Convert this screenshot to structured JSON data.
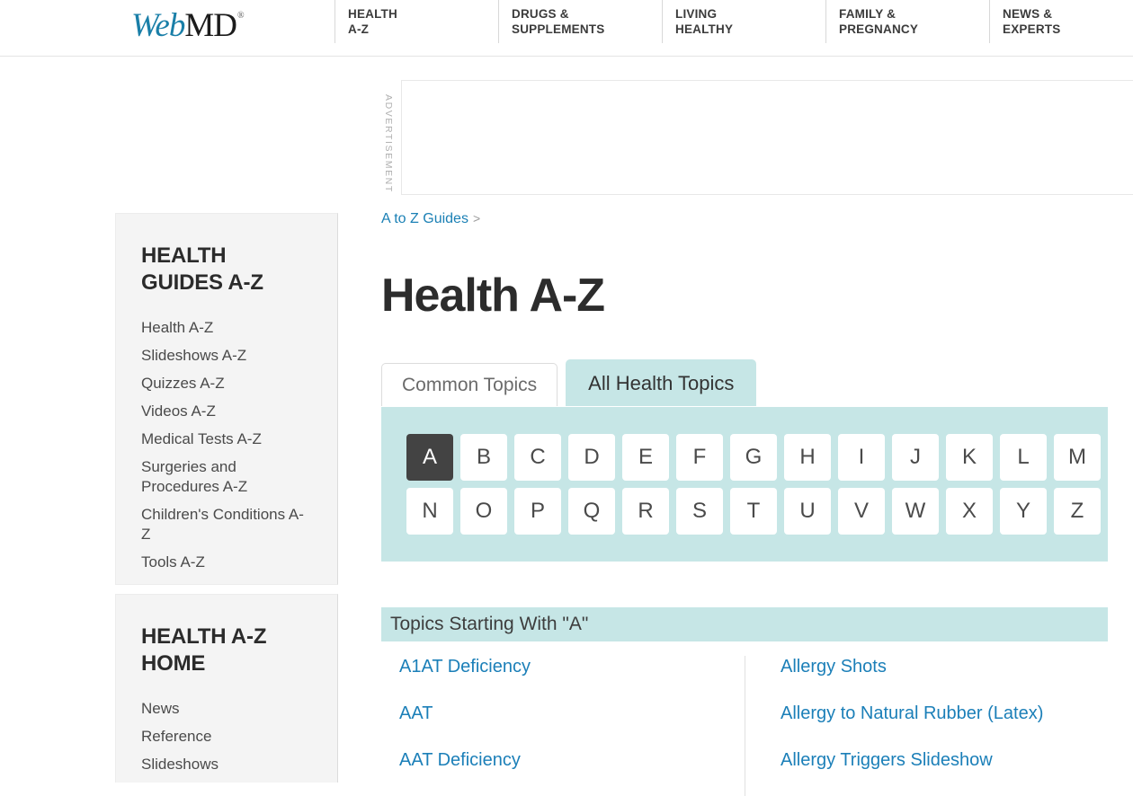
{
  "header": {
    "logo": {
      "part1": "Web",
      "part2": "MD",
      "reg": "®"
    },
    "nav": [
      {
        "line1": "HEALTH",
        "line2": "A-Z"
      },
      {
        "line1": "DRUGS &",
        "line2": "SUPPLEMENTS"
      },
      {
        "line1": "LIVING",
        "line2": "HEALTHY"
      },
      {
        "line1": "FAMILY &",
        "line2": "PREGNANCY"
      },
      {
        "line1": "NEWS &",
        "line2": "EXPERTS"
      }
    ]
  },
  "ad": {
    "label": "ADVERTISEMENT"
  },
  "sidebar": {
    "guides": {
      "title": "HEALTH GUIDES A-Z",
      "items": [
        "Health A-Z",
        "Slideshows A-Z",
        "Quizzes A-Z",
        "Videos A-Z",
        "Medical Tests A-Z",
        "Surgeries and Procedures A-Z",
        "Children's Conditions A-Z",
        "Tools A-Z"
      ]
    },
    "home": {
      "title": "HEALTH A-Z HOME",
      "items": [
        "News",
        "Reference",
        "Slideshows"
      ]
    }
  },
  "main": {
    "breadcrumb": {
      "label": "A to Z Guides",
      "separator": ">"
    },
    "title": "Health A-Z",
    "tabs": [
      {
        "label": "Common Topics",
        "active": false
      },
      {
        "label": "All Health Topics",
        "active": true
      }
    ],
    "letters_row1": [
      "A",
      "B",
      "C",
      "D",
      "E",
      "F",
      "G",
      "H",
      "I",
      "J",
      "K",
      "L",
      "M"
    ],
    "letters_row2": [
      "N",
      "O",
      "P",
      "Q",
      "R",
      "S",
      "T",
      "U",
      "V",
      "W",
      "X",
      "Y",
      "Z"
    ],
    "selected_letter": "A",
    "topics_header": "Topics Starting With \"A\"",
    "topics_left": [
      "A1AT Deficiency",
      "AAT",
      "AAT Deficiency"
    ],
    "topics_right": [
      "Allergy Shots",
      "Allergy to Natural Rubber (Latex)",
      "Allergy Triggers Slideshow"
    ]
  },
  "colors": {
    "accent_teal": "#c6e6e6",
    "link_blue": "#1b7fb8",
    "logo_blue": "#1a7fa8",
    "selected_tile": "#434343",
    "sidebar_bg": "#f4f4f4"
  }
}
